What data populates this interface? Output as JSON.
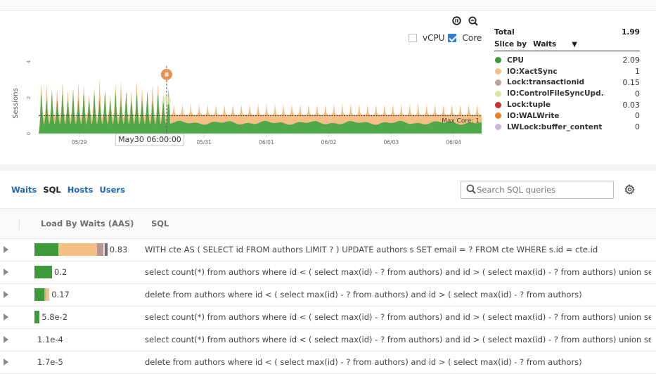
{
  "chart_controls": {
    "pause_icon": "pause-circle-icon",
    "zoom_icon": "zoom-out-icon",
    "vcpu_label": "vCPU",
    "vcpu_checked": false,
    "core_label": "Core",
    "core_checked": true
  },
  "chart_data": {
    "type": "area",
    "stacked": true,
    "title": "",
    "ylabel": "Sessions",
    "xlabel": "",
    "yticks": [
      "0",
      "2",
      "4"
    ],
    "ylim": [
      0,
      4
    ],
    "xlim_days": [
      0,
      7.1
    ],
    "x_ticks": [
      {
        "label": "05/29",
        "day": 0.65
      },
      {
        "label": "05/30",
        "day": 1.65,
        "hidden": true
      },
      {
        "label": "05/31",
        "day": 2.65
      },
      {
        "label": "06/01",
        "day": 3.65
      },
      {
        "label": "06/02",
        "day": 4.65
      },
      {
        "label": "06/03",
        "day": 5.65
      },
      {
        "label": "06/04",
        "day": 6.65
      }
    ],
    "max_core": {
      "value": 1,
      "label": "Max Core: 1"
    },
    "tooltip": {
      "label": "May30 06:00:00",
      "day": 2.05,
      "marker_value": 3.3
    },
    "series": [
      {
        "name": "CPU",
        "color": "#4fa84a",
        "phase1": {
          "from_day": 0,
          "to_day": 2.1,
          "base": 0.9,
          "peak": 2.5,
          "period_days": 0.085
        },
        "phase2": {
          "from_day": 2.1,
          "to_day": 7.1,
          "base": 0.6,
          "wobble": 0.1
        }
      },
      {
        "name": "IO:XactSync",
        "color": "#f4b87a",
        "phase1": {
          "from_day": 0,
          "to_day": 2.1,
          "peak": 3.2,
          "period_days": 0.085
        },
        "phase2": {
          "from_day": 2.1,
          "to_day": 7.1,
          "base": 1.05,
          "peak": 1.75,
          "period_days": 0.135
        }
      }
    ]
  },
  "legend": {
    "total_label": "Total",
    "total_value": "1.99",
    "slice_by_label": "Slice by",
    "slice_by_value": "Waits",
    "items": [
      {
        "name": "CPU",
        "value": "2.09",
        "color": "#3d9a3b"
      },
      {
        "name": "IO:XactSync",
        "value": "1",
        "color": "#f3bf85"
      },
      {
        "name": "Lock:transactionid",
        "value": "0.15",
        "color": "#c1a09a"
      },
      {
        "name": "IO:ControlFileSyncUpd...",
        "value": "0",
        "color": "#dfe3a6"
      },
      {
        "name": "Lock:tuple",
        "value": "0.03",
        "color": "#c8302c"
      },
      {
        "name": "IO:WALWrite",
        "value": "0",
        "color": "#e8832a"
      },
      {
        "name": "LWLock:buffer_content",
        "value": "0",
        "color": "#c9b7dc"
      }
    ]
  },
  "tabs": [
    {
      "label": "Waits",
      "active": false
    },
    {
      "label": "SQL",
      "active": true
    },
    {
      "label": "Hosts",
      "active": false
    },
    {
      "label": "Users",
      "active": false
    }
  ],
  "search": {
    "placeholder": "Search SQL queries",
    "value": ""
  },
  "table": {
    "columns": [
      "Load By Waits (AAS)",
      "SQL"
    ],
    "rows": [
      {
        "load": "0.83",
        "load_value": 0.83,
        "segments": [
          {
            "wait": "CPU",
            "value": 0.27,
            "color": "#3d9a3b"
          },
          {
            "wait": "IO:XactSync",
            "value": 0.44,
            "color": "#f3bf85"
          },
          {
            "wait": "Lock:transactionid",
            "value": 0.07,
            "color": "#b89691"
          },
          {
            "wait": "IO:ControlFileSyncUpd",
            "value": 0.02,
            "color": "#e9e3d6"
          },
          {
            "wait": "Other",
            "value": 0.03,
            "color": "#6e6e7a"
          }
        ],
        "sql": "WITH cte AS ( SELECT id FROM authors LIMIT ? ) UPDATE authors s SET email = ? FROM cte WHERE s.id = cte.id"
      },
      {
        "load": "0.2",
        "load_value": 0.2,
        "segments": [
          {
            "wait": "CPU",
            "value": 0.2,
            "color": "#3d9a3b"
          }
        ],
        "sql": "select count(*) from authors where id < ( select max(id) - ? from authors) and id > ( select max(id) - ? from authors) union select ..."
      },
      {
        "load": "0.17",
        "load_value": 0.17,
        "segments": [
          {
            "wait": "CPU",
            "value": 0.11,
            "color": "#3d9a3b"
          },
          {
            "wait": "Lock:transactionid",
            "value": 0.02,
            "color": "#c9a98f"
          },
          {
            "wait": "IO:XactSync",
            "value": 0.04,
            "color": "#f3bf85"
          }
        ],
        "sql": "delete from authors where id < ( select max(id) - ? from authors) and id > ( select max(id) - ? from authors)"
      },
      {
        "load": "5.8e-2",
        "load_value": 0.058,
        "segments": [
          {
            "wait": "CPU",
            "value": 0.058,
            "color": "#3d9a3b"
          }
        ],
        "sql": "select count(*) from authors where id < ( select max(id) - ? from authors) and id > ( select max(id) - ? from authors) union select ..."
      },
      {
        "load": "1.1e-4",
        "load_value": 0.00011,
        "segments": [],
        "sql": "select count(*) from authors where id < ( select max(id) - ? from authors) and id > ( select max(id) - ? from authors) union select ..."
      },
      {
        "load": "1.7e-5",
        "load_value": 1.7e-05,
        "segments": [],
        "sql": "delete from authors where id < ( select max(id) - ? from authors) and id > ( select max(id) - ? from authors)"
      }
    ]
  }
}
